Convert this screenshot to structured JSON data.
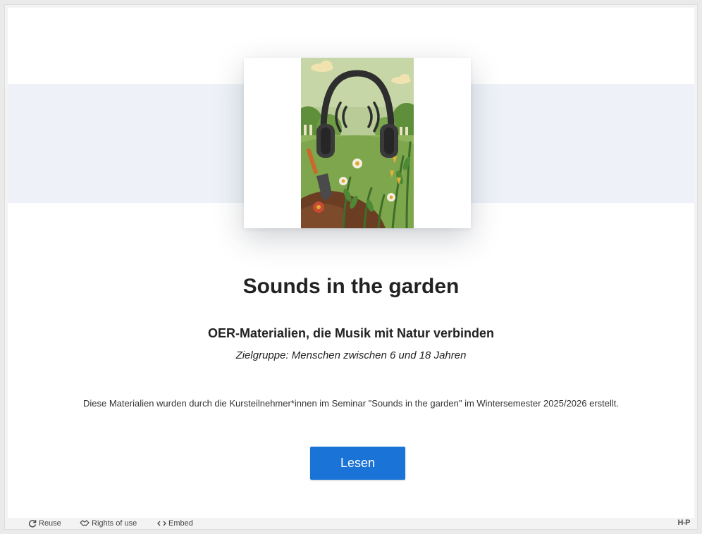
{
  "main": {
    "title": "Sounds in the garden",
    "subtitle": "OER-Materialien, die Musik mit Natur verbinden",
    "audience": "Zielgruppe: Menschen zwischen 6 und 18 Jahren",
    "description": "Diese Materialien wurden durch die Kursteilnehmer*innen im Seminar \"Sounds in the garden\" im Wintersemester 2025/2026 erstellt.",
    "read_button": "Lesen"
  },
  "footer": {
    "reuse_label": "Reuse",
    "rights_label": "Rights of use",
    "embed_label": "Embed",
    "logo_text": "H-P"
  },
  "colors": {
    "accent": "#1a73d6",
    "band": "#eef2f8"
  },
  "icons": [
    "reuse-icon",
    "rights-of-use-icon",
    "embed-icon",
    "h5p-logo"
  ]
}
